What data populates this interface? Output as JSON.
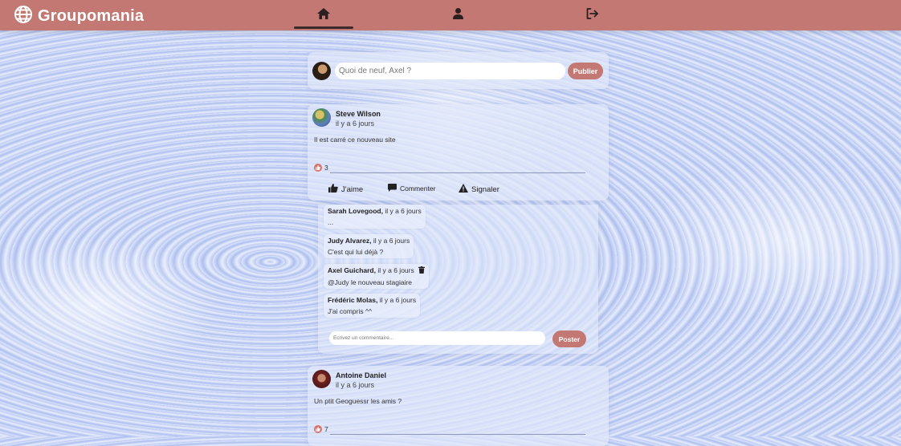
{
  "brand": {
    "name": "Groupomania"
  },
  "composer": {
    "placeholder": "Quoi de neuf, Axel ?",
    "publish_label": "Publier"
  },
  "posts": [
    {
      "author": "Steve Wilson",
      "time": "il y a 6 jours",
      "text": "Il est carré ce nouveau site",
      "likes": "3",
      "actions": {
        "like": "J'aime",
        "comment": "Commenter",
        "report": "Signaler"
      },
      "comments": [
        {
          "author": "Sarah Lovegood,",
          "time": "il y a 6 jours",
          "text": "..."
        },
        {
          "author": "Judy Alvarez,",
          "time": "il y a 6 jours",
          "text": "C'est qui lui déjà ?"
        },
        {
          "author": "Axel Guichard,",
          "time": "il y a 6 jours",
          "text": "@Judy le nouveau stagiaire"
        },
        {
          "author": "Frédéric Molas,",
          "time": "il y a 6 jours",
          "text": "J'ai compris ^^"
        }
      ],
      "comment_placeholder": "Ecrivez un commentaire...",
      "post_comment_label": "Poster"
    },
    {
      "author": "Antoine Daniel",
      "time": "il y a 6 jours",
      "text": "Un ptit Geoguessr les amis ?",
      "likes": "7"
    }
  ],
  "colors": {
    "navbar": "#c47873",
    "accent": "#c47873",
    "like": "#d8726a"
  }
}
